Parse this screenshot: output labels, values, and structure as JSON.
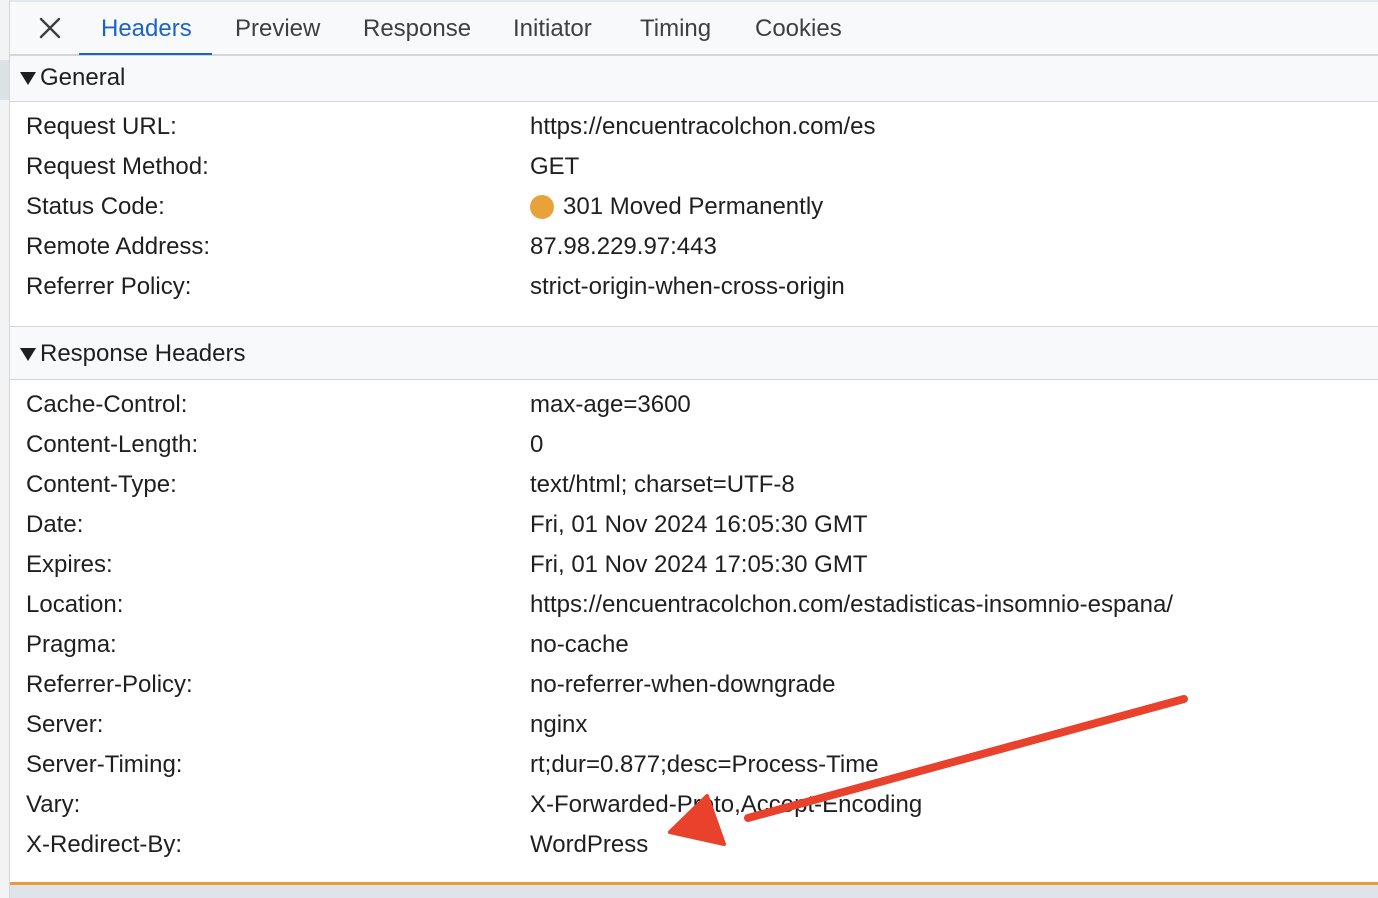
{
  "tabs": {
    "close_icon": "close-icon",
    "items": [
      "Headers",
      "Preview",
      "Response",
      "Initiator",
      "Timing",
      "Cookies"
    ],
    "active": "Headers"
  },
  "general": {
    "title": "General",
    "rows": [
      {
        "key": "Request URL:",
        "value": "https://encuentracolchon.com/es"
      },
      {
        "key": "Request Method:",
        "value": "GET"
      },
      {
        "key": "Status Code:",
        "value": "301 Moved Permanently"
      },
      {
        "key": "Remote Address:",
        "value": "87.98.229.97:443"
      },
      {
        "key": "Referrer Policy:",
        "value": "strict-origin-when-cross-origin"
      }
    ],
    "status_color": "#e8a23a"
  },
  "response_headers": {
    "title": "Response Headers",
    "rows": [
      {
        "key": "Cache-Control:",
        "value": "max-age=3600"
      },
      {
        "key": "Content-Length:",
        "value": "0"
      },
      {
        "key": "Content-Type:",
        "value": "text/html; charset=UTF-8"
      },
      {
        "key": "Date:",
        "value": "Fri, 01 Nov 2024 16:05:30 GMT"
      },
      {
        "key": "Expires:",
        "value": "Fri, 01 Nov 2024 17:05:30 GMT"
      },
      {
        "key": "Location:",
        "value": "https://encuentracolchon.com/estadisticas-insomnio-espana/"
      },
      {
        "key": "Pragma:",
        "value": "no-cache"
      },
      {
        "key": "Referrer-Policy:",
        "value": "no-referrer-when-downgrade"
      },
      {
        "key": "Server:",
        "value": "nginx"
      },
      {
        "key": "Server-Timing:",
        "value": "rt;dur=0.877;desc=Process-Time"
      },
      {
        "key": "Vary:",
        "value": "X-Forwarded-Proto,Accept-Encoding"
      },
      {
        "key": "X-Redirect-By:",
        "value": "WordPress"
      }
    ]
  },
  "annotation": {
    "type": "arrow",
    "color": "#e8412c",
    "points_to": "X-Redirect-By"
  }
}
